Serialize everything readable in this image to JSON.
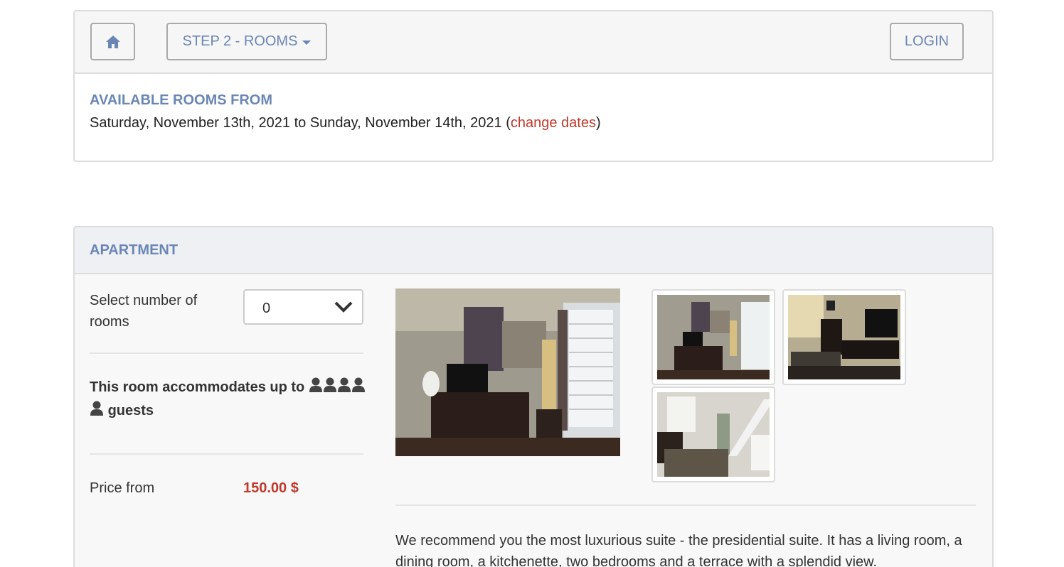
{
  "nav": {
    "home_icon": "home-icon",
    "step_label": "STEP 2 - ROOMS",
    "login_label": "LOGIN"
  },
  "availability": {
    "title": "AVAILABLE ROOMS FROM",
    "dates": "Saturday, November 13th, 2021 to Sunday, November 14th, 2021",
    "open_paren": "(",
    "change_link": "change dates",
    "close_paren": ")"
  },
  "room": {
    "title": "APARTMENT",
    "select_label": "Select number of rooms",
    "select_value": "0",
    "accommodates_prefix": "This room accommodates up to",
    "guest_count": 5,
    "accommodates_suffix": "guests",
    "price_label": "Price from",
    "price_value": "150.00 $",
    "description": "We recommend you the most luxurious suite - the presidential suite. It has a living room, a dining room, a kitchenette, two bedrooms and a terrace with a splendid view."
  },
  "colors": {
    "accent_blue": "#6a86b5",
    "price_red": "#c0392b"
  }
}
